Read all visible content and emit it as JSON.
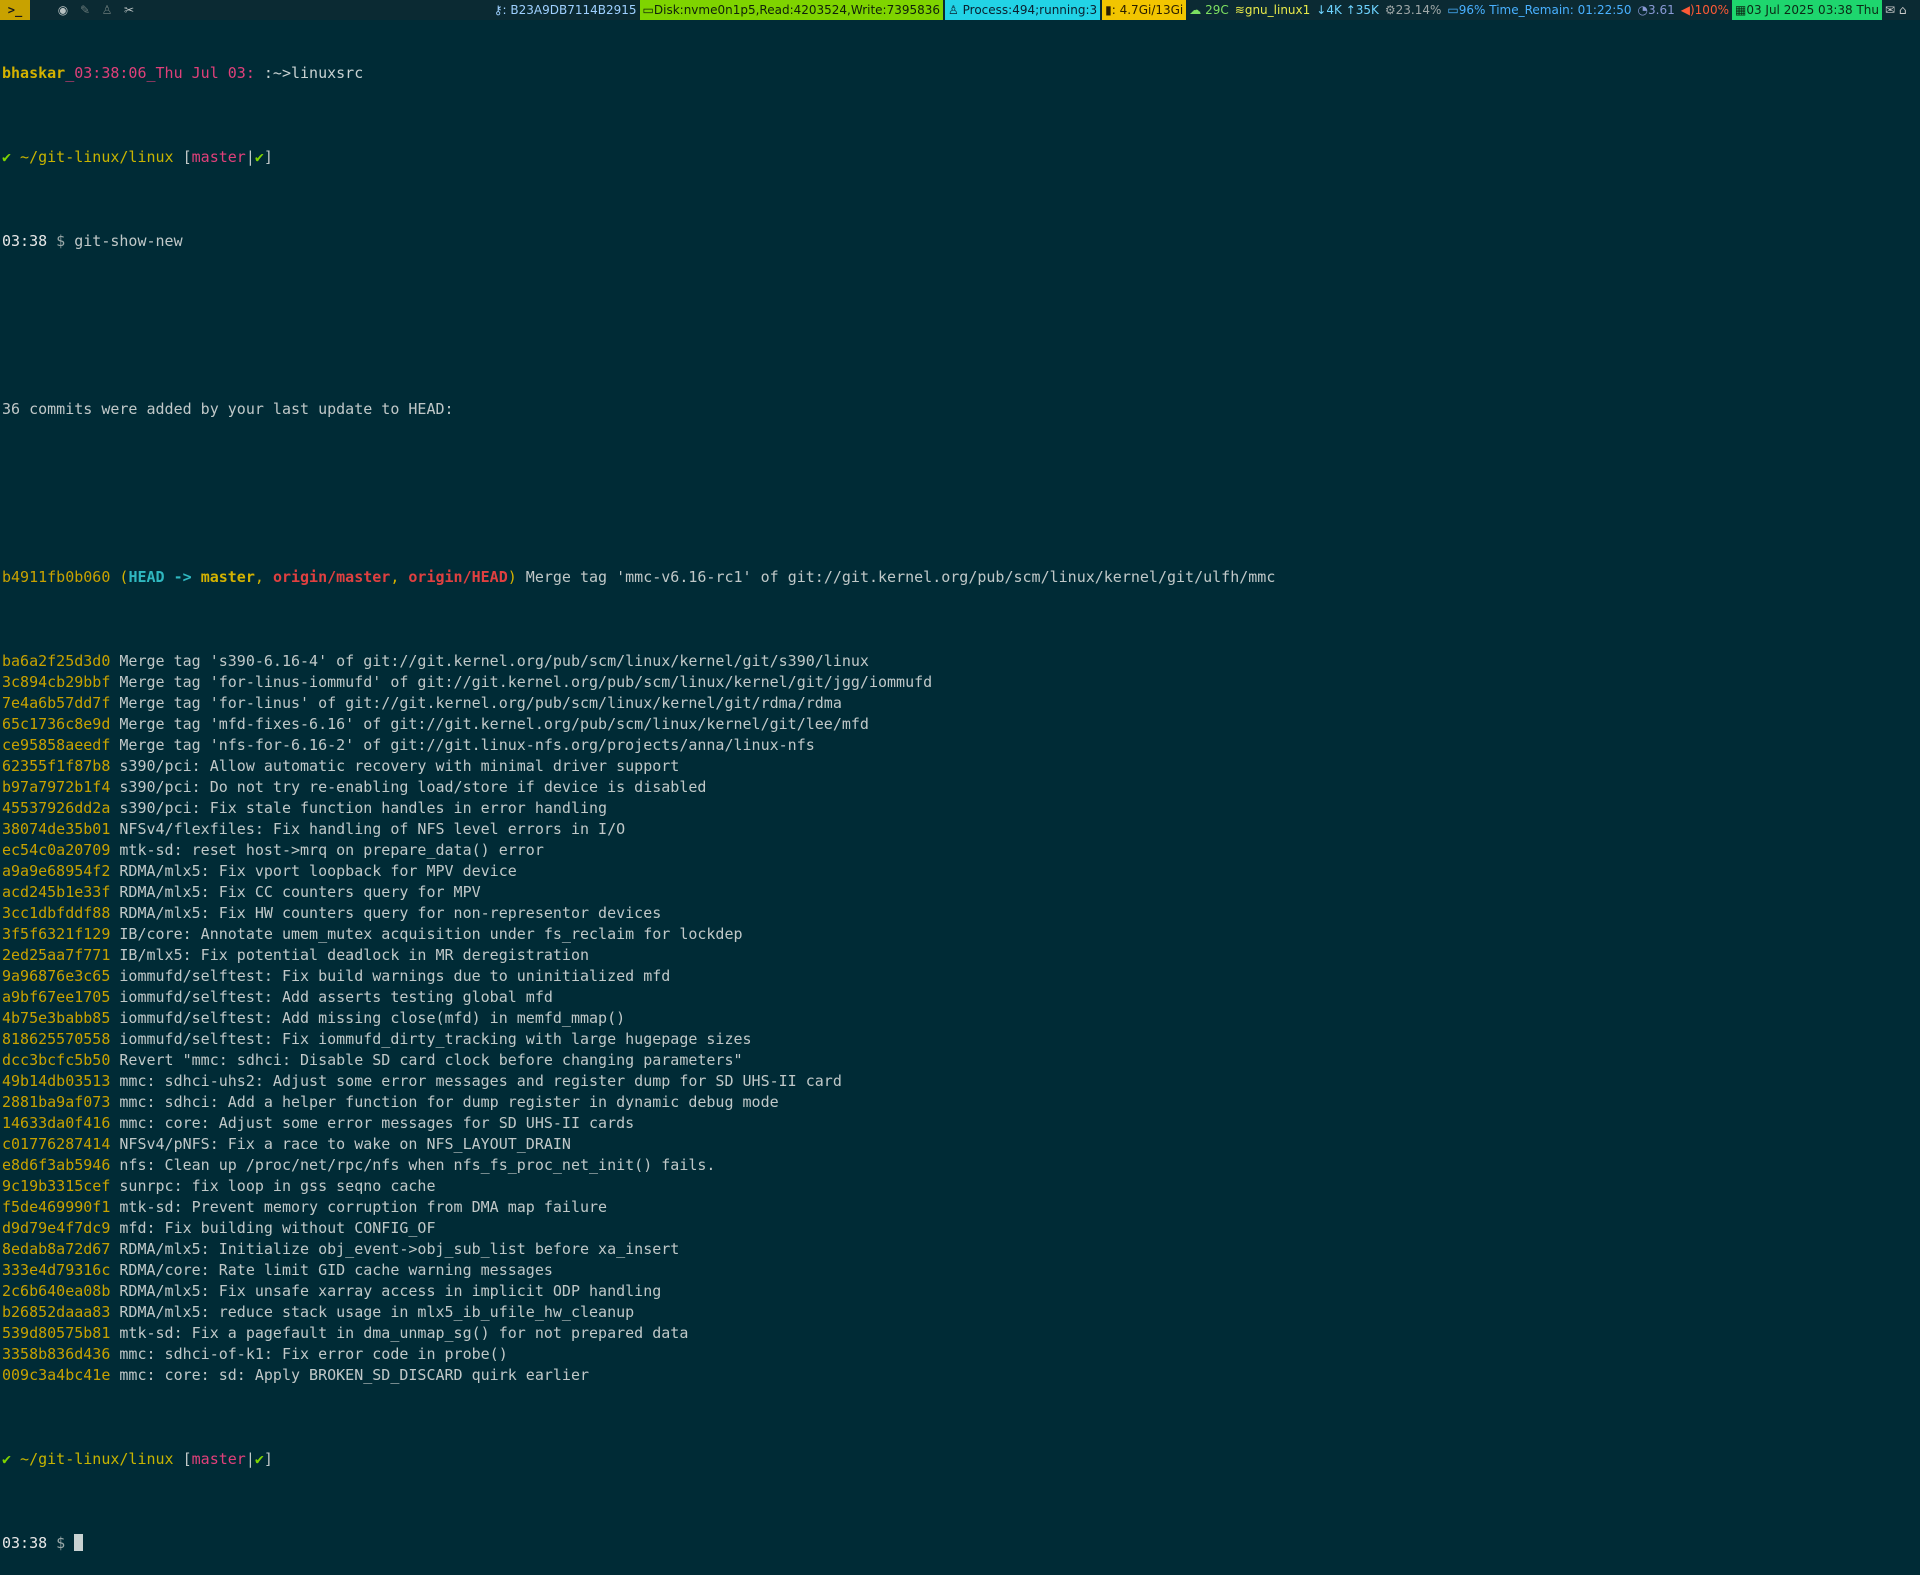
{
  "topbar": {
    "workspace_label": ">_",
    "workspace_icons": [
      "firefox-icon",
      "pen-icon",
      "penguin-icon",
      "tools-icon"
    ],
    "key_id": "B23A9DB7114B2915",
    "disk": "Disk:nvme0n1p5,Read:4203524,Write:7395836",
    "process": "Process:494;running:3",
    "memory": ": 4.7Gi/13Gi",
    "temperature": "29C",
    "wifi": "gnu_linux1",
    "net_down": "4K",
    "net_up": "35K",
    "cpu": "23.14%",
    "battery": "96% Time_Remain: 01:22:50",
    "load": "3.61",
    "volume": "100%",
    "datetime": "03 Jul 2025 03:38 Thu"
  },
  "terminal": {
    "title_line": {
      "user": "bhaskar",
      "clock": "_03:38:06_Thu Jul 03:",
      "path": " :~>linuxsrc"
    },
    "prompt": {
      "check": "✔",
      "cwd": " ~/git-linux/linux ",
      "open": "[",
      "branch": "master",
      "sep": "|",
      "clean": "✔",
      "close": "]",
      "time": "03:38",
      "dollar": " $ "
    },
    "command": "git-show-new",
    "summary": "36 commits were added by your last update to HEAD:",
    "head_commit": {
      "hash": "b4911fb0b060",
      "paren_open": " (",
      "head": "HEAD",
      "arrow": " -> ",
      "master": "master",
      "comma1": ", ",
      "origin_master": "origin/master",
      "comma2": ", ",
      "origin_head": "origin/HEAD",
      "paren_close": ")",
      "message": " Merge tag 'mmc-v6.16-rc1' of git://git.kernel.org/pub/scm/linux/kernel/git/ulfh/mmc"
    },
    "commits": [
      {
        "hash": "ba6a2f25d3d0",
        "message": " Merge tag 's390-6.16-4' of git://git.kernel.org/pub/scm/linux/kernel/git/s390/linux"
      },
      {
        "hash": "3c894cb29bbf",
        "message": " Merge tag 'for-linus-iommufd' of git://git.kernel.org/pub/scm/linux/kernel/git/jgg/iommufd"
      },
      {
        "hash": "7e4a6b57dd7f",
        "message": " Merge tag 'for-linus' of git://git.kernel.org/pub/scm/linux/kernel/git/rdma/rdma"
      },
      {
        "hash": "65c1736c8e9d",
        "message": " Merge tag 'mfd-fixes-6.16' of git://git.kernel.org/pub/scm/linux/kernel/git/lee/mfd"
      },
      {
        "hash": "ce95858aeedf",
        "message": " Merge tag 'nfs-for-6.16-2' of git://git.linux-nfs.org/projects/anna/linux-nfs"
      },
      {
        "hash": "62355f1f87b8",
        "message": " s390/pci: Allow automatic recovery with minimal driver support"
      },
      {
        "hash": "b97a7972b1f4",
        "message": " s390/pci: Do not try re-enabling load/store if device is disabled"
      },
      {
        "hash": "45537926dd2a",
        "message": " s390/pci: Fix stale function handles in error handling"
      },
      {
        "hash": "38074de35b01",
        "message": " NFSv4/flexfiles: Fix handling of NFS level errors in I/O"
      },
      {
        "hash": "ec54c0a20709",
        "message": " mtk-sd: reset host->mrq on prepare_data() error"
      },
      {
        "hash": "a9a9e68954f2",
        "message": " RDMA/mlx5: Fix vport loopback for MPV device"
      },
      {
        "hash": "acd245b1e33f",
        "message": " RDMA/mlx5: Fix CC counters query for MPV"
      },
      {
        "hash": "3cc1dbfddf88",
        "message": " RDMA/mlx5: Fix HW counters query for non-representor devices"
      },
      {
        "hash": "3f5f6321f129",
        "message": " IB/core: Annotate umem_mutex acquisition under fs_reclaim for lockdep"
      },
      {
        "hash": "2ed25aa7f771",
        "message": " IB/mlx5: Fix potential deadlock in MR deregistration"
      },
      {
        "hash": "9a96876e3c65",
        "message": " iommufd/selftest: Fix build warnings due to uninitialized mfd"
      },
      {
        "hash": "a9bf67ee1705",
        "message": " iommufd/selftest: Add asserts testing global mfd"
      },
      {
        "hash": "4b75e3babb85",
        "message": " iommufd/selftest: Add missing close(mfd) in memfd_mmap()"
      },
      {
        "hash": "818625570558",
        "message": " iommufd/selftest: Fix iommufd_dirty_tracking with large hugepage sizes"
      },
      {
        "hash": "dcc3bcfc5b50",
        "message": " Revert \"mmc: sdhci: Disable SD card clock before changing parameters\""
      },
      {
        "hash": "49b14db03513",
        "message": " mmc: sdhci-uhs2: Adjust some error messages and register dump for SD UHS-II card"
      },
      {
        "hash": "2881ba9af073",
        "message": " mmc: sdhci: Add a helper function for dump register in dynamic debug mode"
      },
      {
        "hash": "14633da0f416",
        "message": " mmc: core: Adjust some error messages for SD UHS-II cards"
      },
      {
        "hash": "c01776287414",
        "message": " NFSv4/pNFS: Fix a race to wake on NFS_LAYOUT_DRAIN"
      },
      {
        "hash": "e8d6f3ab5946",
        "message": " nfs: Clean up /proc/net/rpc/nfs when nfs_fs_proc_net_init() fails."
      },
      {
        "hash": "9c19b3315cef",
        "message": " sunrpc: fix loop in gss seqno cache"
      },
      {
        "hash": "f5de469990f1",
        "message": " mtk-sd: Prevent memory corruption from DMA map failure"
      },
      {
        "hash": "d9d79e4f7dc9",
        "message": " mfd: Fix building without CONFIG_OF"
      },
      {
        "hash": "8edab8a72d67",
        "message": " RDMA/mlx5: Initialize obj_event->obj_sub_list before xa_insert"
      },
      {
        "hash": "333e4d79316c",
        "message": " RDMA/core: Rate limit GID cache warning messages"
      },
      {
        "hash": "2c6b640ea08b",
        "message": " RDMA/mlx5: Fix unsafe xarray access in implicit ODP handling"
      },
      {
        "hash": "b26852daaa83",
        "message": " RDMA/mlx5: reduce stack usage in mlx5_ib_ufile_hw_cleanup"
      },
      {
        "hash": "539d80575b81",
        "message": " mtk-sd: Fix a pagefault in dma_unmap_sg() for not prepared data"
      },
      {
        "hash": "3358b836d436",
        "message": " mmc: sdhci-of-k1: Fix error code in probe()"
      },
      {
        "hash": "009c3a4bc41e",
        "message": " mmc: core: sd: Apply BROKEN_SD_DISCARD quirk earlier"
      }
    ]
  }
}
